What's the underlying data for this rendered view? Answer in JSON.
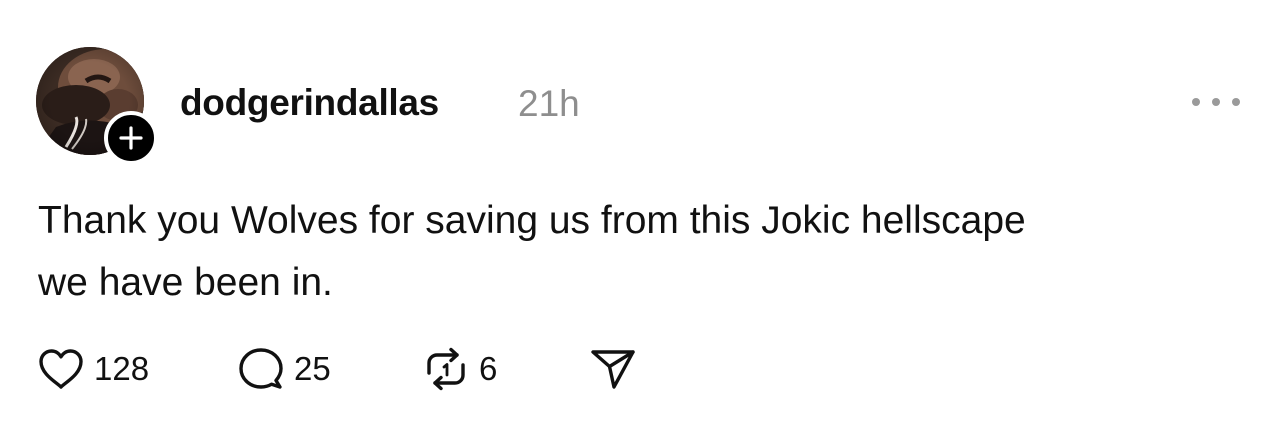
{
  "post": {
    "username": "dodgerindallas",
    "timestamp": "21h",
    "text_lines": [
      "Thank you Wolves for saving us from this Jokic hellscape",
      "we have been in."
    ],
    "actions": {
      "likes": "128",
      "comments": "25",
      "reposts": "6"
    }
  },
  "icons": {
    "follow": "plus-icon",
    "more": "more-options-icon",
    "like": "heart-icon",
    "comment": "comment-bubble-icon",
    "repost": "repost-icon",
    "share": "send-icon"
  },
  "colors": {
    "text": "#111111",
    "muted": "#8e8e8e",
    "badge": "#000000",
    "background": "#ffffff"
  }
}
